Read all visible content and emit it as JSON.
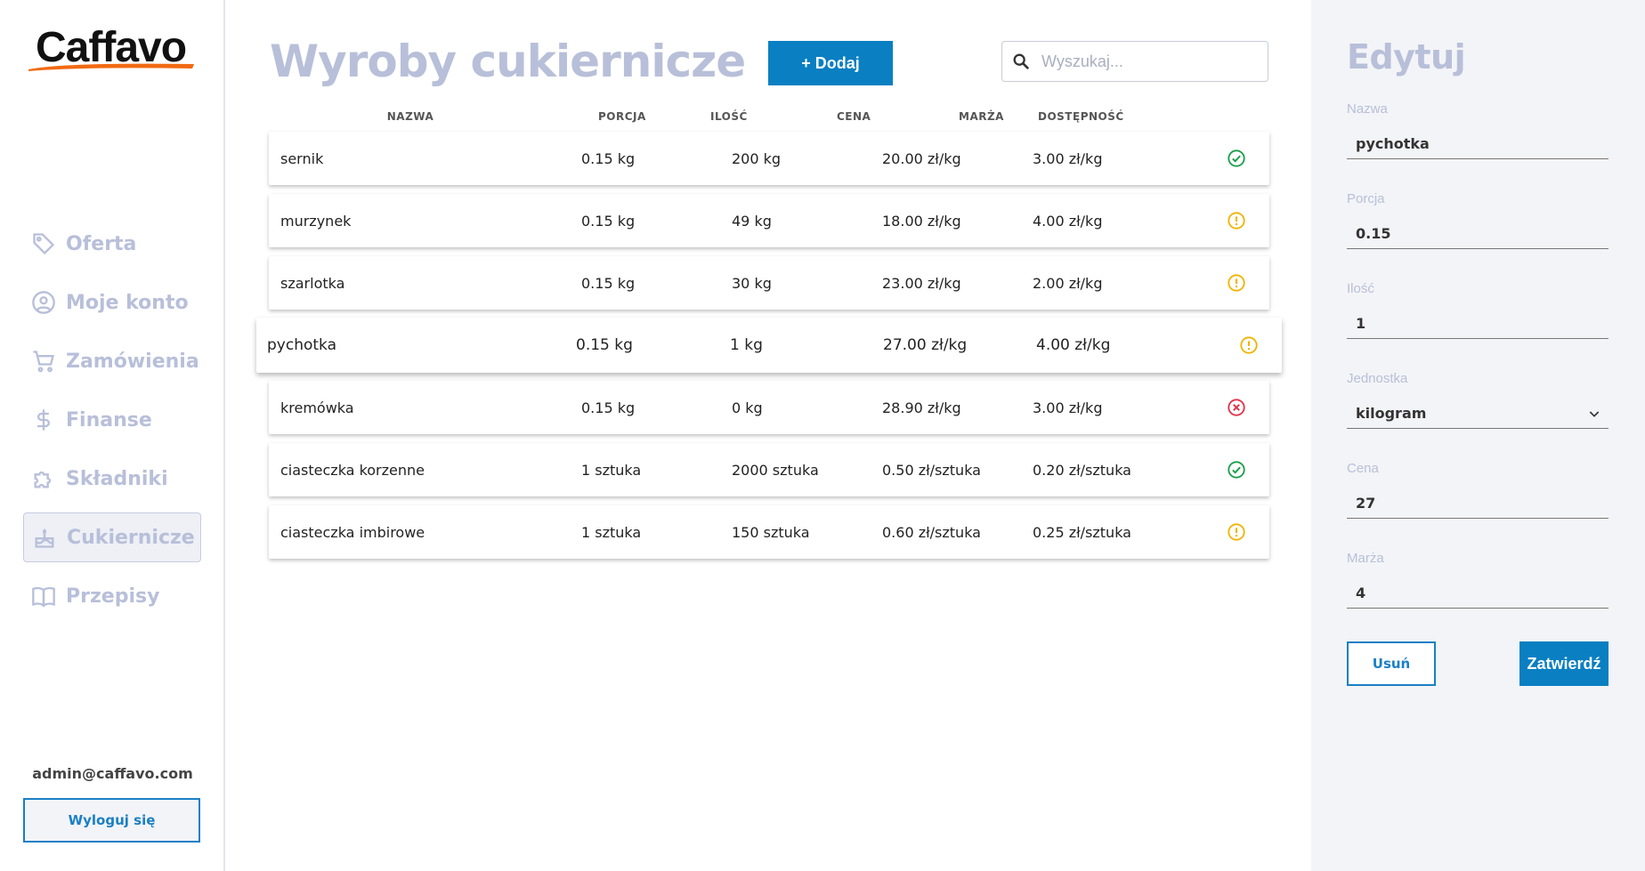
{
  "app": {
    "logo_text": "Caffavo"
  },
  "sidebar": {
    "items": [
      {
        "label": "Oferta",
        "icon": "tag-icon"
      },
      {
        "label": "Moje konto",
        "icon": "user-circle-icon"
      },
      {
        "label": "Zamówienia",
        "icon": "cart-icon"
      },
      {
        "label": "Finanse",
        "icon": "dollar-icon"
      },
      {
        "label": "Składniki",
        "icon": "puzzle-icon"
      },
      {
        "label": "Cukiernicze",
        "icon": "cake-icon",
        "active": true
      },
      {
        "label": "Przepisy",
        "icon": "book-icon"
      }
    ],
    "user_email": "admin@caffavo.com",
    "logout_label": "Wyloguj się"
  },
  "main": {
    "title": "Wyroby cukiernicze",
    "add_label": "+ Dodaj",
    "search_placeholder": "Wyszukaj...",
    "columns": [
      "NAZWA",
      "PORCJA",
      "ILOŚĆ",
      "CENA",
      "MARŻA",
      "DOSTĘPNOŚĆ"
    ],
    "rows": [
      {
        "name": "sernik",
        "portion": "0.15 kg",
        "quantity": "200 kg",
        "price": "20.00 zł/kg",
        "margin": "3.00 zł/kg",
        "availability": "available"
      },
      {
        "name": "murzynek",
        "portion": "0.15 kg",
        "quantity": "49 kg",
        "price": "18.00 zł/kg",
        "margin": "4.00 zł/kg",
        "availability": "low"
      },
      {
        "name": "szarlotka",
        "portion": "0.15 kg",
        "quantity": "30 kg",
        "price": "23.00 zł/kg",
        "margin": "2.00 zł/kg",
        "availability": "low"
      },
      {
        "name": "pychotka",
        "portion": "0.15 kg",
        "quantity": "1 kg",
        "price": "27.00 zł/kg",
        "margin": "4.00 zł/kg",
        "availability": "low",
        "selected": true
      },
      {
        "name": "kremówka",
        "portion": "0.15 kg",
        "quantity": "0 kg",
        "price": "28.90 zł/kg",
        "margin": "3.00 zł/kg",
        "availability": "unavailable"
      },
      {
        "name": "ciasteczka korzenne",
        "portion": "1 sztuka",
        "quantity": "2000 sztuka",
        "price": "0.50 zł/sztuka",
        "margin": "0.20 zł/sztuka",
        "availability": "available"
      },
      {
        "name": "ciasteczka imbirowe",
        "portion": "1 sztuka",
        "quantity": "150 sztuka",
        "price": "0.60 zł/sztuka",
        "margin": "0.25 zł/sztuka",
        "availability": "low"
      }
    ]
  },
  "edit": {
    "title": "Edytuj",
    "fields": [
      {
        "label": "Nazwa",
        "value": "pychotka"
      },
      {
        "label": "Porcja",
        "value": "0.15"
      },
      {
        "label": "Ilość",
        "value": "1"
      },
      {
        "label": "Jednostka",
        "value": "kilogram",
        "type": "select"
      },
      {
        "label": "Cena",
        "value": "27"
      },
      {
        "label": "Marża",
        "value": "4"
      }
    ],
    "delete_label": "Usuń",
    "confirm_label": "Zatwierdź"
  },
  "colors": {
    "accent": "#0a7fc2",
    "muted": "#b8bfd9",
    "available": "#1a9e4a",
    "low": "#f0b400",
    "unavailable": "#e0334a"
  }
}
